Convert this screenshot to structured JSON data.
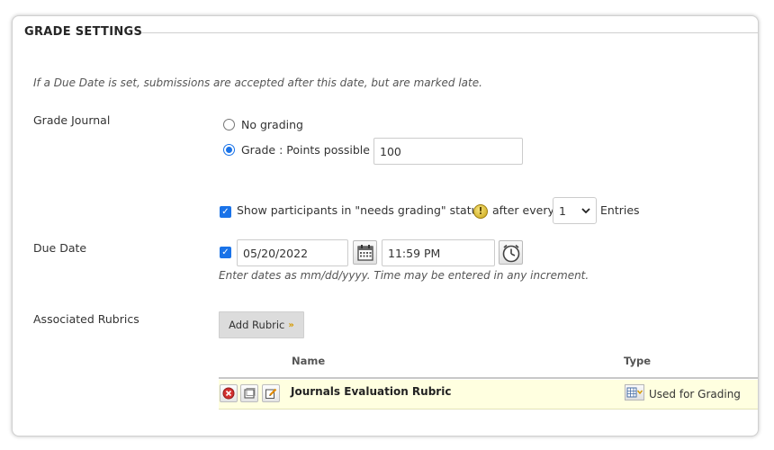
{
  "section": {
    "title": "GRADE SETTINGS",
    "note": "If a Due Date is set, submissions are accepted after this date, but are marked late."
  },
  "grade_journal": {
    "label": "Grade Journal",
    "options": [
      {
        "label": "No grading",
        "checked": false
      },
      {
        "label": "Grade : Points possible :",
        "checked": true
      }
    ],
    "points_possible": "100",
    "show_participants_checked": true,
    "show_participants_label": "Show participants in \"needs grading\" status",
    "after_every_label": "after every",
    "entries_count": "1",
    "entries_label": "Entries"
  },
  "due_date": {
    "label": "Due Date",
    "enabled": true,
    "date": "05/20/2022",
    "time": "11:59 PM",
    "hint": "Enter dates as mm/dd/yyyy. Time may be entered in any increment."
  },
  "rubrics": {
    "label": "Associated Rubrics",
    "add_button_label": "Add Rubric",
    "columns": {
      "name": "Name",
      "type": "Type"
    },
    "rows": [
      {
        "name": "Journals Evaluation Rubric",
        "type": "Used for Grading"
      }
    ]
  },
  "colors": {
    "accent": "#1a73e8",
    "row_highlight": "#ffffe0",
    "button_gray": "#dcdcdc"
  },
  "icons": {
    "help": "help-icon",
    "calendar": "calendar-icon",
    "clock": "clock-icon",
    "remove": "remove-icon",
    "view": "view-icon",
    "edit": "edit-icon",
    "rubric_type": "rubric-type-icon"
  }
}
